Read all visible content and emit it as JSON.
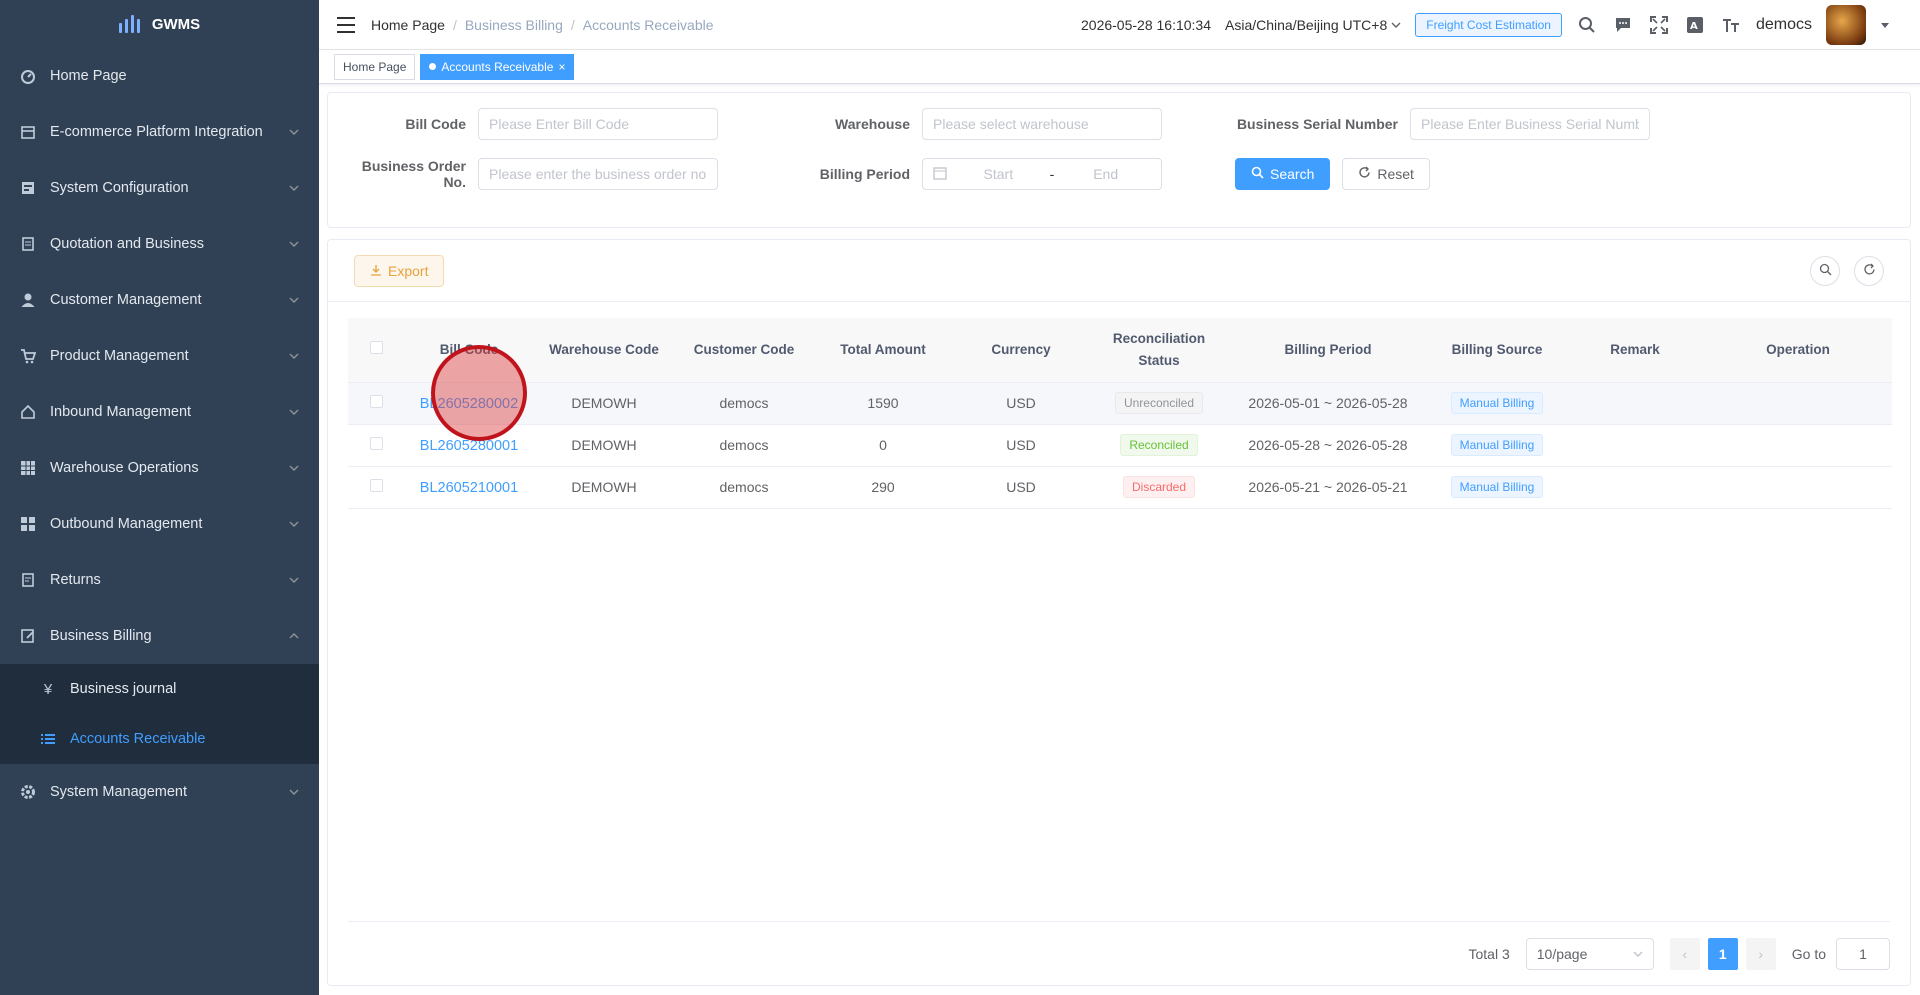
{
  "app": {
    "name": "GWMS"
  },
  "sidebar": {
    "items": [
      {
        "label": "Home Page",
        "icon": "dashboard-icon"
      },
      {
        "label": "E-commerce Platform Integration",
        "icon": "store-icon"
      },
      {
        "label": "System Configuration",
        "icon": "config-icon"
      },
      {
        "label": "Quotation and Business",
        "icon": "quotation-icon"
      },
      {
        "label": "Customer Management",
        "icon": "user-icon"
      },
      {
        "label": "Product Management",
        "icon": "cart-icon"
      },
      {
        "label": "Inbound Management",
        "icon": "home-icon"
      },
      {
        "label": "Warehouse Operations",
        "icon": "grid-icon"
      },
      {
        "label": "Outbound Management",
        "icon": "apps-icon"
      },
      {
        "label": "Returns",
        "icon": "returns-icon"
      },
      {
        "label": "Business Billing",
        "icon": "edit-icon"
      }
    ],
    "billing_sub": [
      {
        "label": "Business journal",
        "icon": "yen-icon"
      },
      {
        "label": "Accounts Receivable",
        "icon": "list-icon"
      }
    ],
    "system_management": {
      "label": "System Management",
      "icon": "gear-icon"
    }
  },
  "header": {
    "breadcrumb": [
      "Home Page",
      "Business Billing",
      "Accounts Receivable"
    ],
    "datetime": "2026-05-28 16:10:34",
    "timezone": "Asia/China/Beijing UTC+8",
    "freight_button": "Freight Cost Estimation",
    "username": "democs"
  },
  "tags": {
    "home": "Home Page",
    "active": "Accounts Receivable"
  },
  "search": {
    "bill_code_label": "Bill Code",
    "bill_code_placeholder": "Please Enter Bill Code",
    "warehouse_label": "Warehouse",
    "warehouse_placeholder": "Please select warehouse",
    "serial_label": "Business Serial Number",
    "serial_placeholder": "Please Enter Business Serial Number",
    "order_label": "Business Order No.",
    "order_placeholder": "Please enter the business order no.",
    "period_label": "Billing Period",
    "period_start": "Start",
    "period_dash": "-",
    "period_end": "End",
    "search_button": "Search",
    "reset_button": "Reset"
  },
  "toolbar": {
    "export_label": "Export"
  },
  "table": {
    "headers": {
      "bill_code": "Bill Code",
      "warehouse_code": "Warehouse Code",
      "customer_code": "Customer Code",
      "total_amount": "Total Amount",
      "currency": "Currency",
      "reconciliation_status": "Reconciliation Status",
      "billing_period": "Billing Period",
      "billing_source": "Billing Source",
      "remark": "Remark",
      "operation": "Operation"
    },
    "rows": [
      {
        "bill_code": "BL2605280002",
        "warehouse_code": "DEMOWH",
        "customer_code": "democs",
        "total_amount": "1590",
        "currency": "USD",
        "status": "Unreconciled",
        "period": "2026-05-01 ~ 2026-05-28",
        "source": "Manual Billing"
      },
      {
        "bill_code": "BL2605280001",
        "warehouse_code": "DEMOWH",
        "customer_code": "democs",
        "total_amount": "0",
        "currency": "USD",
        "status": "Reconciled",
        "period": "2026-05-28 ~ 2026-05-28",
        "source": "Manual Billing"
      },
      {
        "bill_code": "BL2605210001",
        "warehouse_code": "DEMOWH",
        "customer_code": "democs",
        "total_amount": "290",
        "currency": "USD",
        "status": "Discarded",
        "period": "2026-05-21 ~ 2026-05-21",
        "source": "Manual Billing"
      }
    ]
  },
  "pagination": {
    "total": "Total 3",
    "page_size": "10/page",
    "current_page": "1",
    "goto_label": "Go to",
    "goto_value": "1"
  },
  "colors": {
    "sidebar_bg": "#304156",
    "primary": "#409eff",
    "warning": "#e6a23c",
    "success": "#67c23a",
    "danger": "#f56c6c"
  }
}
